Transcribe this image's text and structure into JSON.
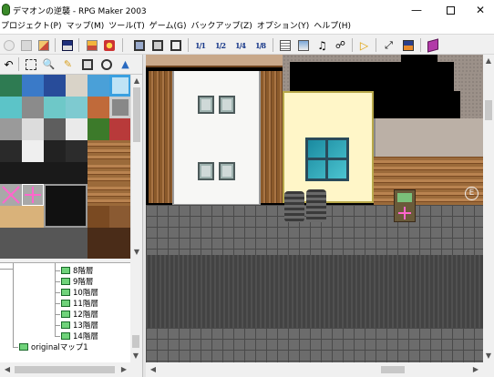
{
  "window": {
    "title": "デマオンの逆襲 - RPG Maker 2003",
    "minimize_icon": "minimize-icon",
    "maximize_icon": "maximize-icon",
    "close_icon": "close-icon"
  },
  "menu": [
    "プロジェクト(P)",
    "マップ(M)",
    "ツール(T)",
    "ゲーム(G)",
    "バックアップ(Z)",
    "オプション(Y)",
    "ヘルプ(H)"
  ],
  "toolbar": {
    "zoom_labels": [
      "1/1",
      "1/2",
      "1/4",
      "1/8"
    ],
    "buttons": [
      "new-project",
      "open-project",
      "close-project",
      "save",
      "lower-layer",
      "upper-layer",
      "event-layer",
      "zoom-1-1",
      "zoom-1-2",
      "zoom-1-4",
      "zoom-1-8",
      "database",
      "material",
      "music",
      "search",
      "playtest",
      "fullscreen",
      "title-screen",
      "help"
    ]
  },
  "draw_tools": [
    "select",
    "zoom",
    "pencil",
    "rectangle",
    "circle",
    "fill"
  ],
  "map_tree": {
    "items": [
      "8階層",
      "9階層",
      "10階層",
      "11階層",
      "12階層",
      "13階層",
      "14階層"
    ],
    "parent": "originalマップ1"
  },
  "map_event_label": "E",
  "colors": {
    "accent": "#3a8a2a",
    "map_icon": "#6fd37a",
    "selection": "#ff66cc"
  }
}
